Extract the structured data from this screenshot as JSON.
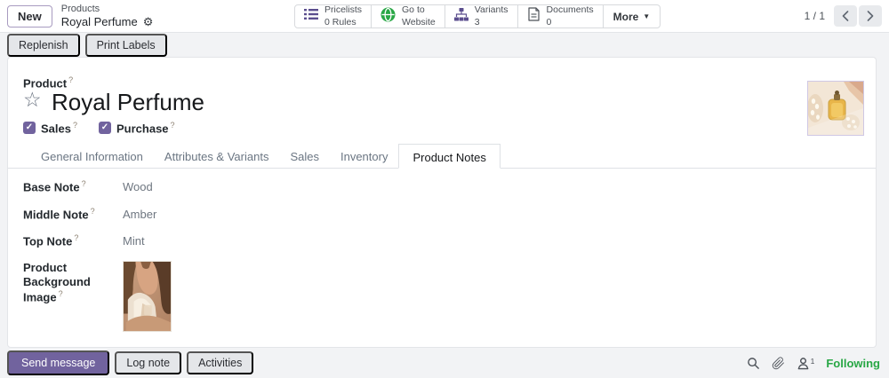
{
  "ui": {
    "help_mark": "?"
  },
  "icons": {
    "gear": "⚙",
    "star": "☆",
    "caret_down": "▼",
    "check": "✓"
  },
  "navbar": {
    "new_label": "New",
    "breadcrumb": {
      "parent": "Products",
      "current": "Royal Perfume"
    },
    "stats": [
      {
        "icon": "pricelists-icon",
        "line1": "Pricelists",
        "line2": "0 Rules"
      },
      {
        "icon": "go-to-website-icon",
        "line1": "Go to",
        "line2": "Website"
      },
      {
        "icon": "variants-icon",
        "line1": "Variants",
        "line2": "3"
      },
      {
        "icon": "documents-icon",
        "line1": "Documents",
        "line2": "0"
      }
    ],
    "more_label": "More",
    "pager": {
      "text": "1 / 1"
    }
  },
  "action_bar": {
    "replenish": "Replenish",
    "print_labels": "Print Labels"
  },
  "form": {
    "model_label": "Product",
    "title": "Royal Perfume",
    "checkboxes": [
      {
        "label": "Sales"
      },
      {
        "label": "Purchase"
      }
    ],
    "tabs": [
      {
        "label": "General Information"
      },
      {
        "label": "Attributes & Variants"
      },
      {
        "label": "Sales"
      },
      {
        "label": "Inventory"
      },
      {
        "label": "Product Notes"
      }
    ],
    "active_tab": "Product Notes",
    "fields": [
      {
        "label": "Base Note",
        "value": "Wood"
      },
      {
        "label": "Middle Note",
        "value": "Amber"
      },
      {
        "label": "Top Note",
        "value": "Mint"
      },
      {
        "label": "Product Background Image",
        "value": ""
      }
    ]
  },
  "chatter": {
    "send_message": "Send message",
    "log_note": "Log note",
    "activities": "Activities",
    "follower_count": "1",
    "following": "Following"
  },
  "colors": {
    "primary": "#71639e",
    "success": "#28a745",
    "icon_purple": "#5b4e8e",
    "icon_green": "#28a745"
  }
}
